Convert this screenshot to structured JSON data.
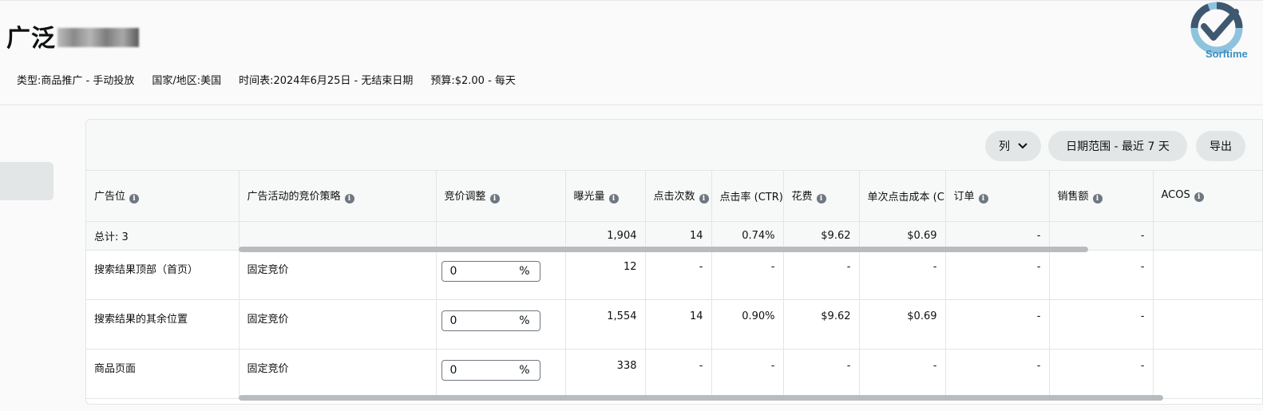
{
  "header": {
    "title": "广泛",
    "meta": {
      "type": "类型:商品推广 - 手动投放",
      "country": "国家/地区:美国",
      "schedule": "时间表:2024年6月25日 - 无结束日期",
      "budget": "预算:$2.00 - 每天"
    },
    "logo_text": "Sorftime"
  },
  "toolbar": {
    "columns_label": "列",
    "date_range_label": "日期范围 - 最近 7 天",
    "export_label": "导出"
  },
  "table": {
    "headers": [
      "广告位",
      "广告活动的竞价策略",
      "竞价调整",
      "曝光量",
      "点击次数",
      "点击率 (CTR)",
      "花费",
      "单次点击成本 (CPC)",
      "订单",
      "销售额",
      "ACOS"
    ],
    "total": {
      "label": "总计: 3",
      "impressions": "1,904",
      "clicks": "14",
      "ctr": "0.74%",
      "spend": "$9.62",
      "cpc": "$0.69",
      "orders": "-",
      "sales": "-",
      "acos": "-"
    },
    "rows": [
      {
        "placement": "搜索结果顶部（首页）",
        "strategy": "固定竞价",
        "bid": "0",
        "unit": "%",
        "impressions": "12",
        "clicks": "-",
        "ctr": "-",
        "spend": "-",
        "cpc": "-",
        "orders": "-",
        "sales": "-",
        "acos": "-"
      },
      {
        "placement": "搜索结果的其余位置",
        "strategy": "固定竞价",
        "bid": "0",
        "unit": "%",
        "impressions": "1,554",
        "clicks": "14",
        "ctr": "0.90%",
        "spend": "$9.62",
        "cpc": "$0.69",
        "orders": "-",
        "sales": "-",
        "acos": "-"
      },
      {
        "placement": "商品页面",
        "strategy": "固定竞价",
        "bid": "0",
        "unit": "%",
        "impressions": "338",
        "clicks": "-",
        "ctr": "-",
        "spend": "-",
        "cpc": "-",
        "orders": "-",
        "sales": "-",
        "acos": "-"
      }
    ]
  },
  "colors": {
    "background": "#fafafa",
    "button_bg": "#e3e6e6",
    "border": "#e3e6e6",
    "info_icon": "#6f7780",
    "logo_dark": "#3f5870",
    "logo_light": "#8fc3dd"
  }
}
